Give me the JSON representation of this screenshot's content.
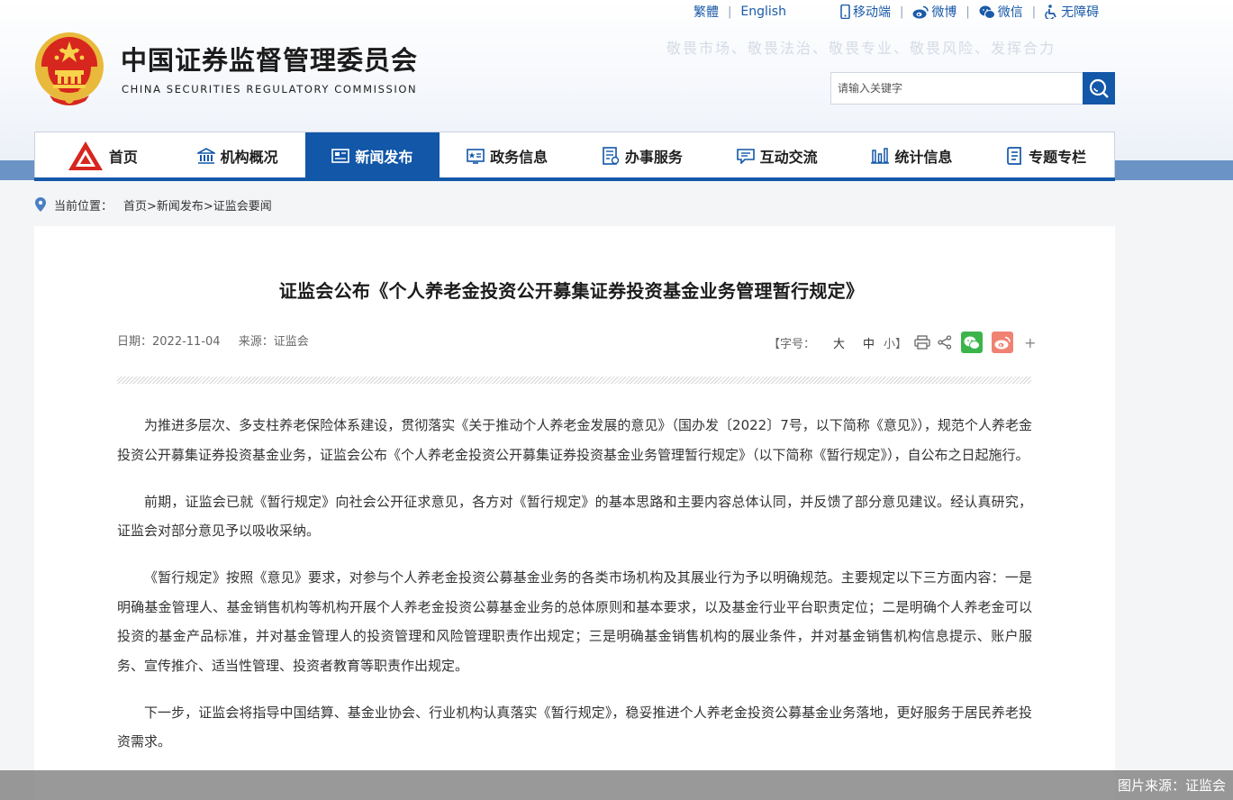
{
  "header": {
    "top_links": {
      "traditional": "繁體",
      "english": "English",
      "mobile": "移动端",
      "weibo": "微博",
      "wechat": "微信",
      "accessibility": "无障碍"
    },
    "slogan": "敬畏市场、敬畏法治、敬畏专业、敬畏风险、发挥合力",
    "org_name_cn": "中国证券监督管理委员会",
    "org_name_en": "CHINA SECURITIES REGULATORY COMMISSION",
    "search": {
      "placeholder": "请输入关键字"
    }
  },
  "nav": {
    "items": [
      {
        "label": "首页"
      },
      {
        "label": "机构概况"
      },
      {
        "label": "新闻发布",
        "active": true
      },
      {
        "label": "政务信息"
      },
      {
        "label": "办事服务"
      },
      {
        "label": "互动交流"
      },
      {
        "label": "统计信息"
      },
      {
        "label": "专题专栏"
      }
    ]
  },
  "breadcrumb": {
    "label": "当前位置：",
    "path": "首页>新闻发布>证监会要闻"
  },
  "article": {
    "title": "证监会公布《个人养老金投资公开募集证券投资基金业务管理暂行规定》",
    "date": "日期：2022-11-04",
    "source": "来源：证监会",
    "font_size": {
      "label": "【字号：",
      "large": "大",
      "medium": "中",
      "small": "小】"
    },
    "share_plus": "+",
    "paragraphs": [
      "为推进多层次、多支柱养老保险体系建设，贯彻落实《关于推动个人养老金发展的意见》（国办发〔2022〕7号，以下简称《意见》），规范个人养老金投资公开募集证券投资基金业务，证监会公布《个人养老金投资公开募集证券投资基金业务管理暂行规定》（以下简称《暂行规定》），自公布之日起施行。",
      "前期，证监会已就《暂行规定》向社会公开征求意见，各方对《暂行规定》的基本思路和主要内容总体认同，并反馈了部分意见建议。经认真研究，证监会对部分意见予以吸收采纳。",
      "《暂行规定》按照《意见》要求，对参与个人养老金投资公募基金业务的各类市场机构及其展业行为予以明确规范。主要规定以下三方面内容：一是明确基金管理人、基金销售机构等机构开展个人养老金投资公募基金业务的总体原则和基本要求，以及基金行业平台职责定位；二是明确个人养老金可以投资的基金产品标准，并对基金管理人的投资管理和风险管理职责作出规定；三是明确基金销售机构的展业条件，并对基金销售机构信息提示、账户服务、宣传推介、适当性管理、投资者教育等职责作出规定。",
      "下一步，证监会将指导中国结算、基金业协会、行业机构认真落实《暂行规定》，稳妥推进个人养老金投资公募基金业务落地，更好服务于居民养老投资需求。"
    ]
  },
  "footer_caption": "图片来源：证监会",
  "colors": {
    "brand_blue": "#1257a8",
    "band_blue": "#6b93c5",
    "wechat_green": "#3bb54a",
    "weibo_red": "#f08273"
  }
}
